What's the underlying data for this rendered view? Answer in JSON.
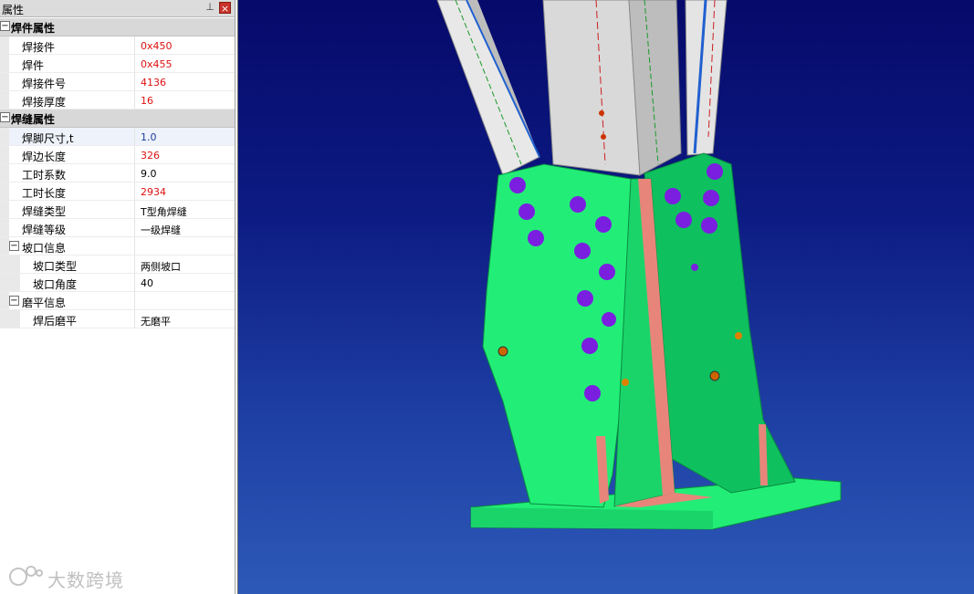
{
  "panel": {
    "title": "属性",
    "pin_icon": "pin-icon",
    "close_icon": "close-icon",
    "categories": [
      {
        "label": "焊件属性",
        "toggle": "⊟",
        "rows": [
          {
            "name": "焊接件",
            "value": "0x450",
            "color": "#dd1111"
          },
          {
            "name": "焊件",
            "value": "0x455",
            "color": "#dd1111"
          },
          {
            "name": "焊接件号",
            "value": "4136",
            "color": "#dd1111"
          },
          {
            "name": "焊接厚度",
            "value": "16",
            "color": "#dd1111"
          }
        ]
      },
      {
        "label": "焊缝属性",
        "toggle": "⊟",
        "rows": [
          {
            "name": "焊脚尺寸,t",
            "value": "1.0",
            "color": "#1a3aa0"
          },
          {
            "name": "焊边长度",
            "value": "326",
            "color": "#dd1111"
          },
          {
            "name": "工时系数",
            "value": "9.0",
            "color": "#000000"
          },
          {
            "name": "工时长度",
            "value": "2934",
            "color": "#dd1111"
          },
          {
            "name": "焊缝类型",
            "value": "T型角焊缝",
            "color": "#000000"
          },
          {
            "name": "焊缝等级",
            "value": "一级焊缝",
            "color": "#000000"
          }
        ],
        "groups": [
          {
            "label": "坡口信息",
            "toggle": "⊟",
            "rows": [
              {
                "name": "坡口类型",
                "value": "两侧坡口",
                "color": "#000000"
              },
              {
                "name": "坡口角度",
                "value": "40",
                "color": "#000000"
              }
            ]
          },
          {
            "label": "磨平信息",
            "toggle": "⊟",
            "rows": [
              {
                "name": "焊后磨平",
                "value": "无磨平",
                "color": "#000000"
              }
            ]
          }
        ]
      }
    ]
  },
  "watermark": {
    "text": "大数跨境"
  },
  "viewport": {
    "background_top": "#060a6a",
    "background_bottom": "#2d59b8",
    "plate_color": "#22ee77",
    "plate_dark": "#0fb85a",
    "weld_color": "#e8857a",
    "member_color": "#d9d9d9",
    "bolt_color": "#7a1fe0"
  }
}
